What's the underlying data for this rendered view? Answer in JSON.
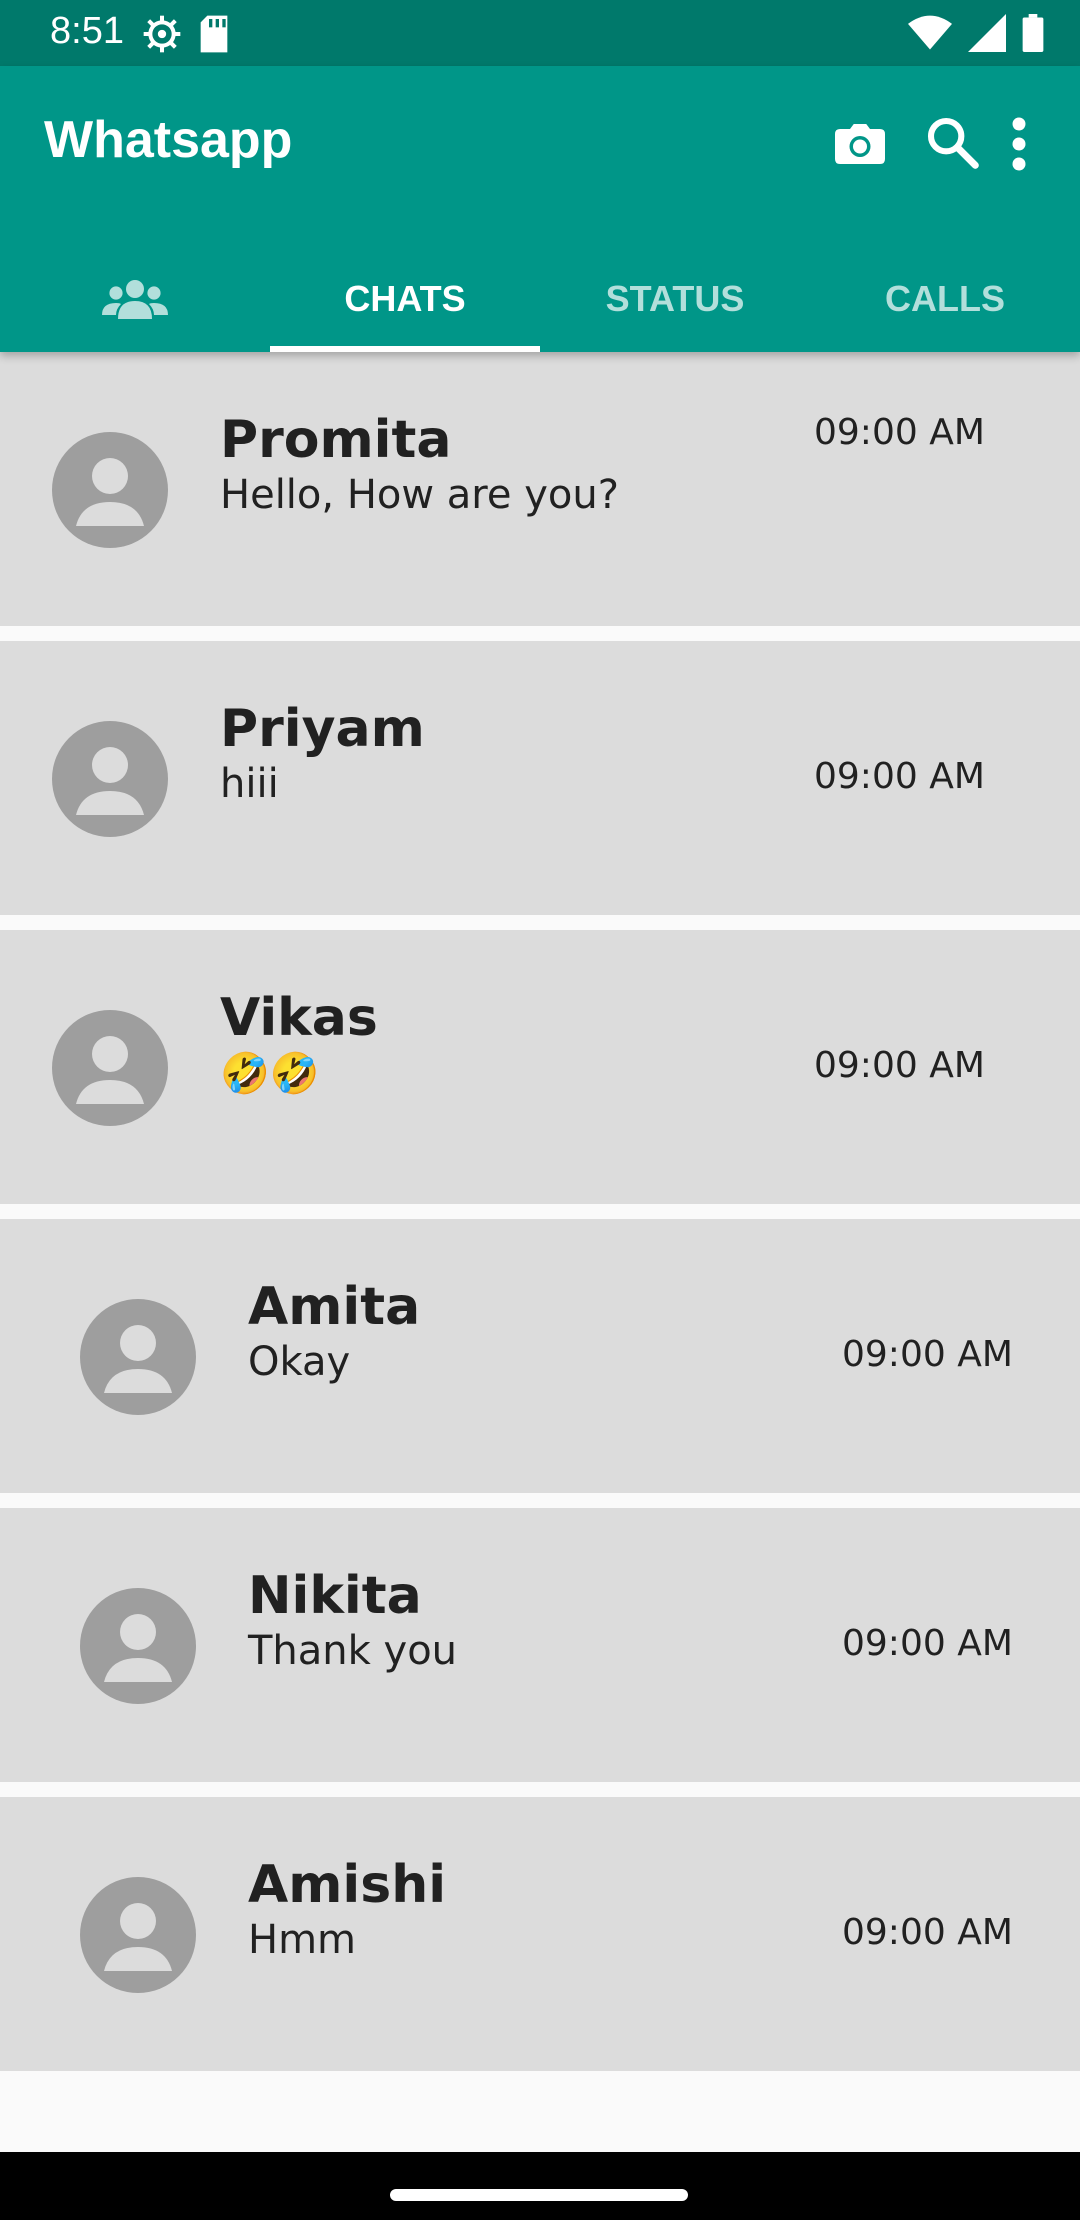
{
  "status_bar": {
    "time": "8:51",
    "left_icons": [
      "settings-gear-icon",
      "sd-card-icon"
    ],
    "right_icons": [
      "wifi-icon",
      "cellular-signal-icon",
      "battery-icon"
    ]
  },
  "app_bar": {
    "title": "Whatsapp",
    "actions": [
      "camera-icon",
      "search-icon",
      "more-vert-icon"
    ],
    "background": "#009688"
  },
  "tabs": [
    {
      "label": "",
      "icon": "community-icon",
      "active": false
    },
    {
      "label": "CHATS",
      "active": true
    },
    {
      "label": "STATUS",
      "active": false
    },
    {
      "label": "CALLS",
      "active": false
    }
  ],
  "chats": [
    {
      "name": "Promita",
      "message": "Hello, How are you?",
      "time": "09:00 AM"
    },
    {
      "name": "Priyam",
      "message": "hiii",
      "time": "09:00 AM"
    },
    {
      "name": "Vikas",
      "message": "🤣🤣",
      "time": "09:00 AM"
    },
    {
      "name": "Amita",
      "message": "Okay",
      "time": "09:00 AM"
    },
    {
      "name": "Nikita",
      "message": "Thank you",
      "time": "09:00 AM"
    },
    {
      "name": "Amishi",
      "message": "Hmm",
      "time": "09:00 AM"
    }
  ]
}
